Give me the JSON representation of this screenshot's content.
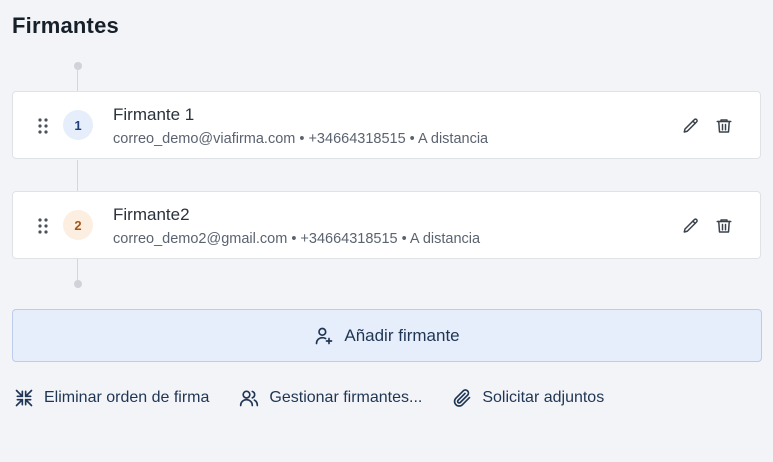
{
  "page": {
    "title": "Firmantes"
  },
  "signers": [
    {
      "order": "1",
      "name": "Firmante 1",
      "details": "correo_demo@viafirma.com • +34664318515 • A distancia"
    },
    {
      "order": "2",
      "name": "Firmante2",
      "details": "correo_demo2@gmail.com • +34664318515 • A distancia"
    }
  ],
  "add_button": {
    "label": "Añadir firmante",
    "icon": "user-plus-icon"
  },
  "actions": [
    {
      "label": "Eliminar orden de firma",
      "icon": "shrink-arrows-icon"
    },
    {
      "label": "Gestionar firmantes...",
      "icon": "users-icon"
    },
    {
      "label": "Solicitar adjuntos",
      "icon": "paperclip-icon"
    }
  ],
  "colors": {
    "accent": "#1f3554",
    "add_button_bg": "#e6eefb",
    "badge1_bg": "#e6eefb",
    "badge2_bg": "#fcefe2",
    "badge2_text": "#a4561a"
  }
}
